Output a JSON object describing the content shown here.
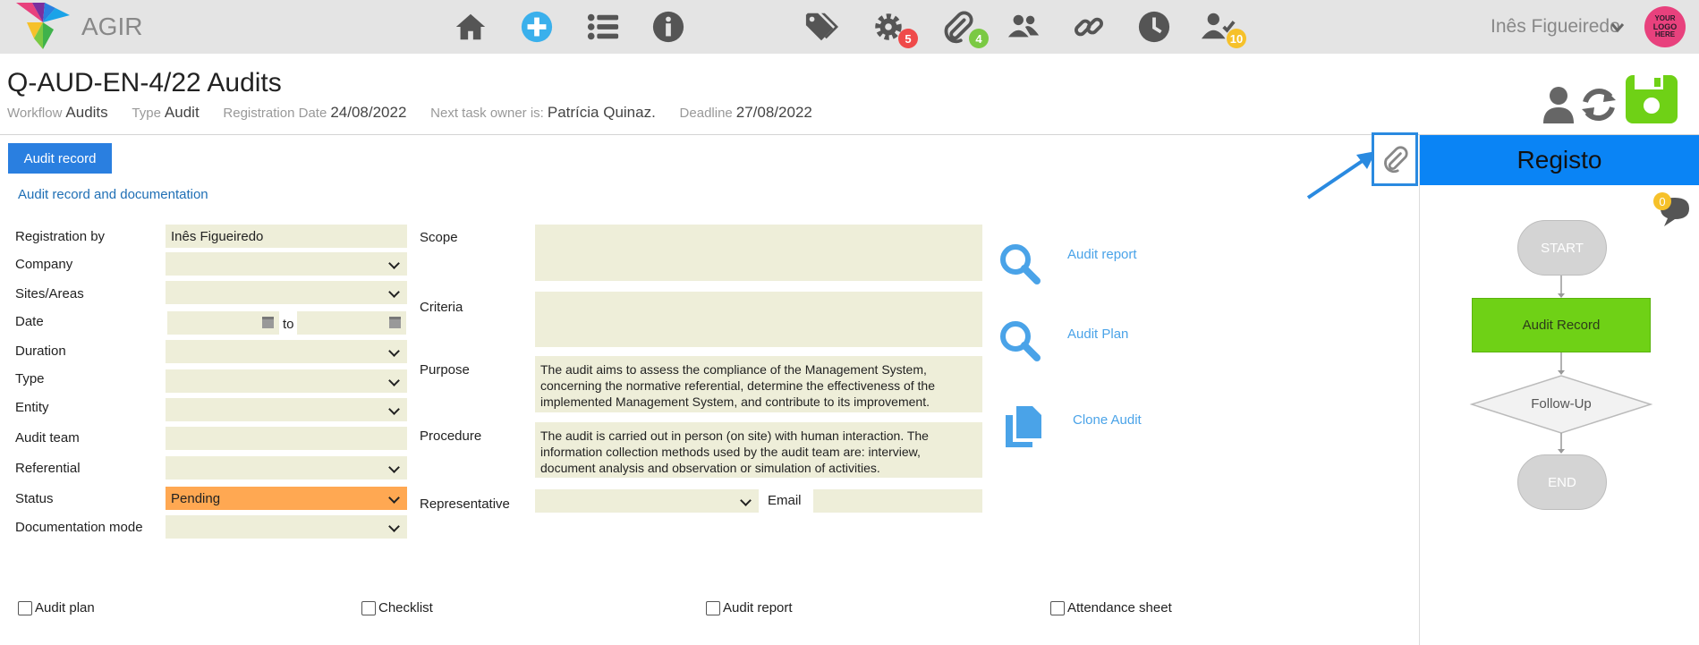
{
  "app": {
    "name": "AGIR"
  },
  "nav": {
    "icons": [
      "home-icon",
      "add-circle-icon",
      "list-icon",
      "info-icon",
      "tags-icon",
      "gear-icon",
      "paperclip-icon",
      "users-icon",
      "link-icon",
      "clock-icon",
      "user-check-icon"
    ],
    "badges": {
      "settings": "5",
      "attachments": "4",
      "tasks": "10"
    }
  },
  "user": {
    "name": "Inês Figueiredo",
    "logo_text": [
      "YOUR",
      "LOGO",
      "HERE"
    ]
  },
  "header": {
    "title": "Q-AUD-EN-4/22 Audits",
    "workflow_label": "Workflow",
    "workflow_value": "Audits",
    "type_label": "Type",
    "type_value": "Audit",
    "regdate_label": "Registration Date",
    "regdate_value": "24/08/2022",
    "owner_label": "Next task owner is:",
    "owner_value": "Patrícia Quinaz.",
    "deadline_label": "Deadline",
    "deadline_value": "27/08/2022"
  },
  "form": {
    "tab_button": "Audit record",
    "section_link": "Audit record and documentation",
    "labels": {
      "registration_by": "Registration by",
      "company": "Company",
      "sites": "Sites/Areas",
      "date": "Date",
      "to": "to",
      "duration": "Duration",
      "type": "Type",
      "entity": "Entity",
      "audit_team": "Audit team",
      "referential": "Referential",
      "status": "Status",
      "documentation_mode": "Documentation mode",
      "scope": "Scope",
      "criteria": "Criteria",
      "purpose": "Purpose",
      "procedure": "Procedure",
      "representative": "Representative",
      "email": "Email"
    },
    "values": {
      "registration_by": "Inês Figueiredo",
      "status": "Pending",
      "purpose": "The audit aims to assess the compliance of the Management System, concerning the normative referential, determine the effectiveness of the implemented Management System, and contribute to its improvement.",
      "procedure": "The audit is carried out in person (on site) with human interaction. The information collection methods used by the audit team are: interview, document analysis and observation or simulation of activities."
    },
    "actions": {
      "audit_report": "Audit report",
      "audit_plan": "Audit Plan",
      "clone_audit": "Clone Audit"
    },
    "checkboxes": [
      "Audit plan",
      "Checklist",
      "Audit report",
      "Attendance sheet"
    ]
  },
  "panel": {
    "title": "Registo",
    "chat_count": "0",
    "flow": {
      "start": "START",
      "task": "Audit Record",
      "decision": "Follow-Up",
      "end": "END"
    }
  },
  "colors": {
    "topbar": "#e4e4e4",
    "primary": "#2a7fe0",
    "panel_header": "#0a84f5",
    "field_bg": "#eeeed9",
    "status_pending": "#ffa852",
    "flow_active": "#6fd116",
    "save_green": "#6fd116",
    "badge_red": "#ef4a4a",
    "badge_green": "#7ac943",
    "badge_yellow": "#f6c12a"
  }
}
